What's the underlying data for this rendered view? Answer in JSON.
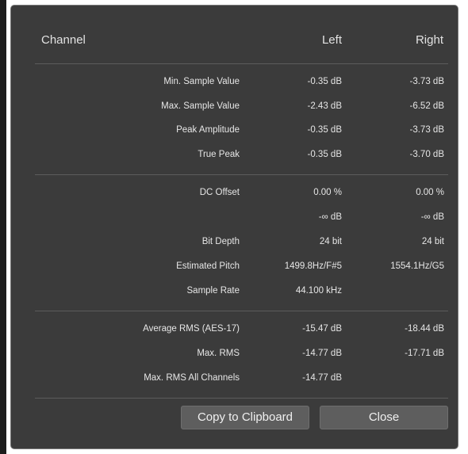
{
  "header": {
    "channel": "Channel",
    "left": "Left",
    "right": "Right"
  },
  "groups": [
    {
      "rows": [
        {
          "label": "Min. Sample Value",
          "left": "-0.35 dB",
          "right": "-3.73 dB"
        },
        {
          "label": "Max. Sample Value",
          "left": "-2.43 dB",
          "right": "-6.52 dB"
        },
        {
          "label": "Peak Amplitude",
          "left": "-0.35 dB",
          "right": "-3.73 dB"
        },
        {
          "label": "True Peak",
          "left": "-0.35 dB",
          "right": "-3.70 dB"
        }
      ]
    },
    {
      "rows": [
        {
          "label": "DC Offset",
          "left": "0.00 %",
          "right": "0.00 %"
        },
        {
          "label": "",
          "left": "-∞ dB",
          "right": "-∞ dB"
        },
        {
          "label": "Bit Depth",
          "left": "24 bit",
          "right": "24 bit"
        },
        {
          "label": "Estimated Pitch",
          "left": "1499.8Hz/F#5",
          "right": "1554.1Hz/G5"
        },
        {
          "label": "Sample Rate",
          "left": "44.100 kHz",
          "right": ""
        }
      ]
    },
    {
      "rows": [
        {
          "label": "Average RMS (AES-17)",
          "left": "-15.47 dB",
          "right": "-18.44 dB"
        },
        {
          "label": "Max. RMS",
          "left": "-14.77 dB",
          "right": "-17.71 dB"
        },
        {
          "label": "Max. RMS All Channels",
          "left": "-14.77 dB",
          "right": ""
        }
      ]
    }
  ],
  "buttons": {
    "copy": "Copy to Clipboard",
    "close": "Close"
  },
  "colors": {
    "dialog_background": "#3b3b3b",
    "separator": "#5c5c5c",
    "button_background": "#5e5e5e",
    "text": "#e6e6e6"
  }
}
